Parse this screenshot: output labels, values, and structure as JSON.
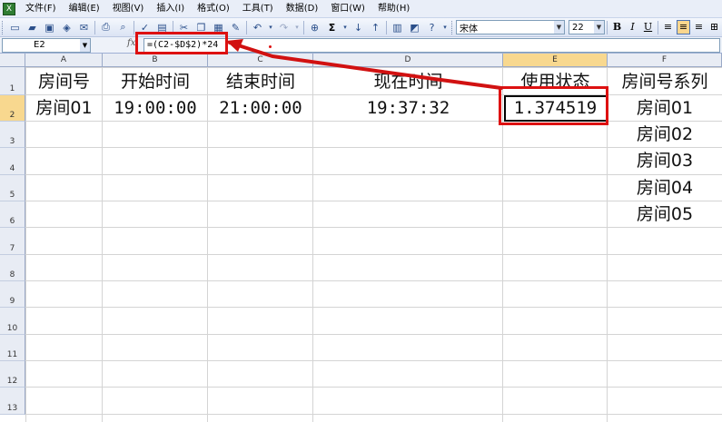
{
  "menu": {
    "items": [
      "文件(F)",
      "编辑(E)",
      "视图(V)",
      "插入(I)",
      "格式(O)",
      "工具(T)",
      "数据(D)",
      "窗口(W)",
      "帮助(H)"
    ]
  },
  "toolbar": {
    "font_name": "宋体",
    "font_size": "22",
    "bold": "B",
    "italic": "I",
    "underline": "U",
    "sigma": "Σ"
  },
  "formula_bar": {
    "name_box": "E2",
    "fx": "fx",
    "formula": "=(C2-$D$2)*24"
  },
  "sheet": {
    "columns": [
      "A",
      "B",
      "C",
      "D",
      "E",
      "F"
    ],
    "rows": [
      "1",
      "2",
      "3",
      "4",
      "5",
      "6",
      "7",
      "8",
      "9",
      "10",
      "11",
      "12",
      "13"
    ],
    "row1": {
      "A": "房间号",
      "B": "开始时间",
      "C": "结束时间",
      "D": "现在时间",
      "E": "使用状态",
      "F": "房间号系列"
    },
    "row2": {
      "A": "房间01",
      "B": "19:00:00",
      "C": "21:00:00",
      "D": "19:37:32",
      "E": "1.374519",
      "F": "房间01"
    },
    "colF": {
      "r3": "房间02",
      "r4": "房间03",
      "r5": "房间04",
      "r6": "房间05"
    }
  },
  "colors": {
    "annotation": "#d11111",
    "selected_header": "#f8d88f"
  }
}
